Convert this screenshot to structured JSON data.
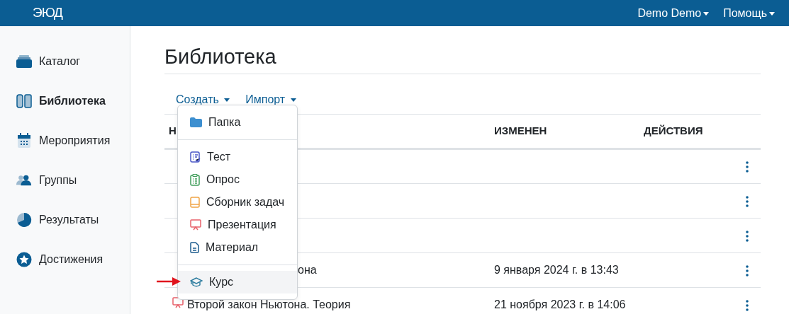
{
  "navbar": {
    "logo": "ЭЮД",
    "menus": [
      "Demo Demo",
      "Помощь"
    ]
  },
  "sidebar": {
    "items": [
      {
        "label": "Каталог",
        "selected": false
      },
      {
        "label": "Библиотека",
        "selected": true
      },
      {
        "label": "Мероприятия",
        "selected": false
      },
      {
        "label": "Группы",
        "selected": false
      },
      {
        "label": "Результаты",
        "selected": false
      },
      {
        "label": "Достижения",
        "selected": false
      }
    ]
  },
  "page": {
    "title": "Библиотека"
  },
  "toolbar": [
    {
      "label": "Создать",
      "expanded": true
    },
    {
      "label": "Импорт",
      "expanded": false
    }
  ],
  "create_menu": [
    {
      "kind": "folder",
      "label": "Папка",
      "hovered": false
    },
    {
      "kind": "divider"
    },
    {
      "kind": "test",
      "label": "Тест",
      "hovered": false
    },
    {
      "kind": "poll",
      "label": "Опрос",
      "hovered": false
    },
    {
      "kind": "book",
      "label": "Сборник задач",
      "hovered": false
    },
    {
      "kind": "presentation",
      "label": "Презентация",
      "hovered": false
    },
    {
      "kind": "document",
      "label": "Материал",
      "hovered": false
    },
    {
      "kind": "divider"
    },
    {
      "kind": "course",
      "label": "Курс",
      "hovered": true
    }
  ],
  "table": {
    "columns": [
      "Н",
      "ИЗМЕНЕН",
      "ДЕЙСТВИЯ"
    ],
    "rows": [
      {
        "name": "",
        "modified": ""
      },
      {
        "name": "",
        "modified": ""
      },
      {
        "name": "",
        "modified": ""
      },
      {
        "name": "она",
        "modified": "9 января 2024 г. в 13:43"
      },
      {
        "kind": "presentation",
        "name": "Второй закон Ньютона. Теория",
        "modified": "21 ноября 2023 г. в 14:06"
      }
    ]
  },
  "annotation": {
    "arrow": true
  }
}
